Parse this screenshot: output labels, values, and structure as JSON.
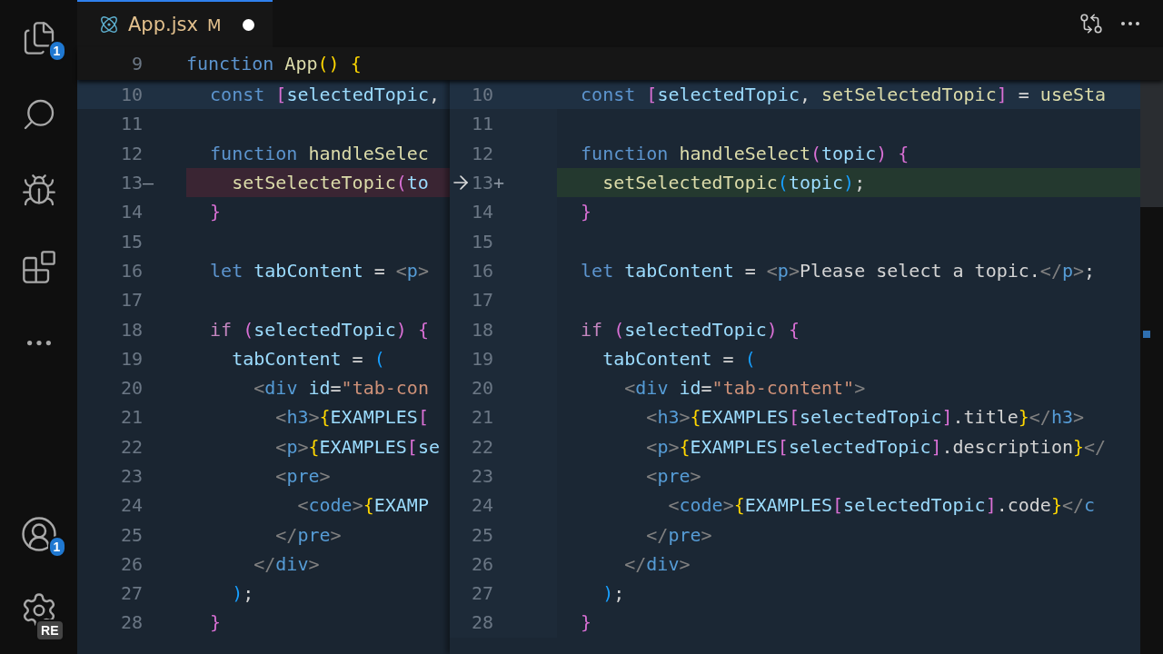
{
  "activity_bar": {
    "items": [
      {
        "kind": "files",
        "badge": "1"
      },
      {
        "kind": "search"
      },
      {
        "kind": "run-debug"
      },
      {
        "kind": "extensions"
      },
      {
        "kind": "more"
      }
    ],
    "bottom": [
      {
        "kind": "account",
        "badge": "1"
      },
      {
        "kind": "settings",
        "badge": "RE"
      }
    ]
  },
  "tab": {
    "name": "App.jsx",
    "status": "M",
    "modified": true,
    "selected": true
  },
  "sticky_line": {
    "number": "9",
    "tokens": [
      {
        "kind": "kw",
        "text": "function"
      },
      {
        "kind": "fn",
        "text": " App"
      },
      {
        "kind": "b1",
        "text": "()"
      },
      {
        "kind": "b1",
        "text": " {"
      }
    ]
  },
  "left_lines": [
    {
      "number": "10",
      "current": true,
      "tokens": [
        {
          "kind": "kw",
          "text": "  const"
        },
        {
          "kind": "b2",
          "text": " ["
        },
        {
          "kind": "var",
          "text": "selectedTopic"
        },
        {
          "kind": "txt",
          "text": ","
        }
      ]
    },
    {
      "number": "11"
    },
    {
      "number": "12",
      "tokens": [
        {
          "kind": "kw",
          "text": "  function"
        },
        {
          "kind": "fn",
          "text": " handleSelec"
        }
      ]
    },
    {
      "number": "13",
      "marker": "—",
      "changed": true,
      "revert": true,
      "tokens": [
        {
          "kind": "fn",
          "text": "    setSelecteTopic"
        },
        {
          "kind": "b2",
          "text": "("
        },
        {
          "kind": "var",
          "text": "to"
        }
      ]
    },
    {
      "number": "14",
      "tokens": [
        {
          "kind": "b2",
          "text": "  }"
        }
      ]
    },
    {
      "number": "15"
    },
    {
      "number": "16",
      "tokens": [
        {
          "kind": "kw",
          "text": "  let"
        },
        {
          "kind": "var",
          "text": " tabContent"
        },
        {
          "kind": "txt",
          "text": " ="
        },
        {
          "kind": "tag",
          "text": " <"
        },
        {
          "kind": "tn",
          "text": "p"
        },
        {
          "kind": "tag",
          "text": ">"
        }
      ]
    },
    {
      "number": "17"
    },
    {
      "number": "18",
      "tokens": [
        {
          "kind": "ctl",
          "text": "  if"
        },
        {
          "kind": "b2",
          "text": " ("
        },
        {
          "kind": "var",
          "text": "selectedTopic"
        },
        {
          "kind": "b2",
          "text": ")"
        },
        {
          "kind": "b2",
          "text": " {"
        }
      ]
    },
    {
      "number": "19",
      "tokens": [
        {
          "kind": "var",
          "text": "    tabContent"
        },
        {
          "kind": "txt",
          "text": " ="
        },
        {
          "kind": "b3",
          "text": " ("
        }
      ]
    },
    {
      "number": "20",
      "tokens": [
        {
          "kind": "tag",
          "text": "      <"
        },
        {
          "kind": "tn",
          "text": "div"
        },
        {
          "kind": "attr",
          "text": " id"
        },
        {
          "kind": "txt",
          "text": "="
        },
        {
          "kind": "str",
          "text": "\"tab-con"
        }
      ]
    },
    {
      "number": "21",
      "tokens": [
        {
          "kind": "tag",
          "text": "        <"
        },
        {
          "kind": "tn",
          "text": "h3"
        },
        {
          "kind": "tag",
          "text": ">"
        },
        {
          "kind": "b1",
          "text": "{"
        },
        {
          "kind": "var",
          "text": "EXAMPLES"
        },
        {
          "kind": "b2",
          "text": "["
        }
      ]
    },
    {
      "number": "22",
      "tokens": [
        {
          "kind": "tag",
          "text": "        <"
        },
        {
          "kind": "tn",
          "text": "p"
        },
        {
          "kind": "tag",
          "text": ">"
        },
        {
          "kind": "b1",
          "text": "{"
        },
        {
          "kind": "var",
          "text": "EXAMPLES"
        },
        {
          "kind": "b2",
          "text": "["
        },
        {
          "kind": "var",
          "text": "se"
        }
      ]
    },
    {
      "number": "23",
      "tokens": [
        {
          "kind": "tag",
          "text": "        <"
        },
        {
          "kind": "tn",
          "text": "pre"
        },
        {
          "kind": "tag",
          "text": ">"
        }
      ]
    },
    {
      "number": "24",
      "tokens": [
        {
          "kind": "tag",
          "text": "          <"
        },
        {
          "kind": "tn",
          "text": "code"
        },
        {
          "kind": "tag",
          "text": ">"
        },
        {
          "kind": "b1",
          "text": "{"
        },
        {
          "kind": "var",
          "text": "EXAMP"
        }
      ]
    },
    {
      "number": "25",
      "tokens": [
        {
          "kind": "tag",
          "text": "        </"
        },
        {
          "kind": "tn",
          "text": "pre"
        },
        {
          "kind": "tag",
          "text": ">"
        }
      ]
    },
    {
      "number": "26",
      "tokens": [
        {
          "kind": "tag",
          "text": "      </"
        },
        {
          "kind": "tn",
          "text": "div"
        },
        {
          "kind": "tag",
          "text": ">"
        }
      ]
    },
    {
      "number": "27",
      "tokens": [
        {
          "kind": "b3",
          "text": "    )"
        },
        {
          "kind": "txt",
          "text": ";"
        }
      ]
    },
    {
      "number": "28",
      "tokens": [
        {
          "kind": "b2",
          "text": "  }"
        }
      ]
    }
  ],
  "right_lines": [
    {
      "number": "10",
      "current": true,
      "tokens": [
        {
          "kind": "kw",
          "text": "  const"
        },
        {
          "kind": "b2",
          "text": " ["
        },
        {
          "kind": "var",
          "text": "selectedTopic"
        },
        {
          "kind": "txt",
          "text": ","
        },
        {
          "kind": "fn",
          "text": " setSelectedTopic"
        },
        {
          "kind": "b2",
          "text": "]"
        },
        {
          "kind": "txt",
          "text": " ="
        },
        {
          "kind": "fn",
          "text": " useSta"
        }
      ]
    },
    {
      "number": "11"
    },
    {
      "number": "12",
      "tokens": [
        {
          "kind": "kw",
          "text": "  function"
        },
        {
          "kind": "fn",
          "text": " handleSelect"
        },
        {
          "kind": "b2",
          "text": "("
        },
        {
          "kind": "var",
          "text": "topic"
        },
        {
          "kind": "b2",
          "text": ")"
        },
        {
          "kind": "b2",
          "text": " {"
        }
      ]
    },
    {
      "number": "13",
      "marker": "+",
      "changed": true,
      "tokens": [
        {
          "kind": "fn",
          "text": "    setSelectedTopic"
        },
        {
          "kind": "b3",
          "text": "("
        },
        {
          "kind": "var",
          "text": "topic"
        },
        {
          "kind": "b3",
          "text": ")"
        },
        {
          "kind": "txt",
          "text": ";"
        }
      ]
    },
    {
      "number": "14",
      "tokens": [
        {
          "kind": "b2",
          "text": "  }"
        }
      ]
    },
    {
      "number": "15"
    },
    {
      "number": "16",
      "tokens": [
        {
          "kind": "kw",
          "text": "  let"
        },
        {
          "kind": "var",
          "text": " tabContent"
        },
        {
          "kind": "txt",
          "text": " ="
        },
        {
          "kind": "tag",
          "text": " <"
        },
        {
          "kind": "tn",
          "text": "p"
        },
        {
          "kind": "tag",
          "text": ">"
        },
        {
          "kind": "txt",
          "text": "Please select a topic."
        },
        {
          "kind": "tag",
          "text": "</"
        },
        {
          "kind": "tn",
          "text": "p"
        },
        {
          "kind": "tag",
          "text": ">"
        },
        {
          "kind": "txt",
          "text": ";"
        }
      ]
    },
    {
      "number": "17"
    },
    {
      "number": "18",
      "tokens": [
        {
          "kind": "ctl",
          "text": "  if"
        },
        {
          "kind": "b2",
          "text": " ("
        },
        {
          "kind": "var",
          "text": "selectedTopic"
        },
        {
          "kind": "b2",
          "text": ")"
        },
        {
          "kind": "b2",
          "text": " {"
        }
      ]
    },
    {
      "number": "19",
      "tokens": [
        {
          "kind": "var",
          "text": "    tabContent"
        },
        {
          "kind": "txt",
          "text": " ="
        },
        {
          "kind": "b3",
          "text": " ("
        }
      ]
    },
    {
      "number": "20",
      "tokens": [
        {
          "kind": "tag",
          "text": "      <"
        },
        {
          "kind": "tn",
          "text": "div"
        },
        {
          "kind": "attr",
          "text": " id"
        },
        {
          "kind": "txt",
          "text": "="
        },
        {
          "kind": "str",
          "text": "\"tab-content\""
        },
        {
          "kind": "tag",
          "text": ">"
        }
      ]
    },
    {
      "number": "21",
      "tokens": [
        {
          "kind": "tag",
          "text": "        <"
        },
        {
          "kind": "tn",
          "text": "h3"
        },
        {
          "kind": "tag",
          "text": ">"
        },
        {
          "kind": "b1",
          "text": "{"
        },
        {
          "kind": "var",
          "text": "EXAMPLES"
        },
        {
          "kind": "b2",
          "text": "["
        },
        {
          "kind": "var",
          "text": "selectedTopic"
        },
        {
          "kind": "b2",
          "text": "]"
        },
        {
          "kind": "txt",
          "text": ".title"
        },
        {
          "kind": "b1",
          "text": "}"
        },
        {
          "kind": "tag",
          "text": "</"
        },
        {
          "kind": "tn",
          "text": "h3"
        },
        {
          "kind": "tag",
          "text": ">"
        }
      ]
    },
    {
      "number": "22",
      "tokens": [
        {
          "kind": "tag",
          "text": "        <"
        },
        {
          "kind": "tn",
          "text": "p"
        },
        {
          "kind": "tag",
          "text": ">"
        },
        {
          "kind": "b1",
          "text": "{"
        },
        {
          "kind": "var",
          "text": "EXAMPLES"
        },
        {
          "kind": "b2",
          "text": "["
        },
        {
          "kind": "var",
          "text": "selectedTopic"
        },
        {
          "kind": "b2",
          "text": "]"
        },
        {
          "kind": "txt",
          "text": ".description"
        },
        {
          "kind": "b1",
          "text": "}"
        },
        {
          "kind": "tag",
          "text": "</"
        }
      ]
    },
    {
      "number": "23",
      "tokens": [
        {
          "kind": "tag",
          "text": "        <"
        },
        {
          "kind": "tn",
          "text": "pre"
        },
        {
          "kind": "tag",
          "text": ">"
        }
      ]
    },
    {
      "number": "24",
      "tokens": [
        {
          "kind": "tag",
          "text": "          <"
        },
        {
          "kind": "tn",
          "text": "code"
        },
        {
          "kind": "tag",
          "text": ">"
        },
        {
          "kind": "b1",
          "text": "{"
        },
        {
          "kind": "var",
          "text": "EXAMPLES"
        },
        {
          "kind": "b2",
          "text": "["
        },
        {
          "kind": "var",
          "text": "selectedTopic"
        },
        {
          "kind": "b2",
          "text": "]"
        },
        {
          "kind": "txt",
          "text": ".code"
        },
        {
          "kind": "b1",
          "text": "}"
        },
        {
          "kind": "tag",
          "text": "</"
        },
        {
          "kind": "tn",
          "text": "c"
        }
      ]
    },
    {
      "number": "25",
      "tokens": [
        {
          "kind": "tag",
          "text": "        </"
        },
        {
          "kind": "tn",
          "text": "pre"
        },
        {
          "kind": "tag",
          "text": ">"
        }
      ]
    },
    {
      "number": "26",
      "tokens": [
        {
          "kind": "tag",
          "text": "      </"
        },
        {
          "kind": "tn",
          "text": "div"
        },
        {
          "kind": "tag",
          "text": ">"
        }
      ]
    },
    {
      "number": "27",
      "tokens": [
        {
          "kind": "b3",
          "text": "    )"
        },
        {
          "kind": "txt",
          "text": ";"
        }
      ]
    },
    {
      "number": "28",
      "tokens": [
        {
          "kind": "b2",
          "text": "  }"
        }
      ]
    }
  ]
}
